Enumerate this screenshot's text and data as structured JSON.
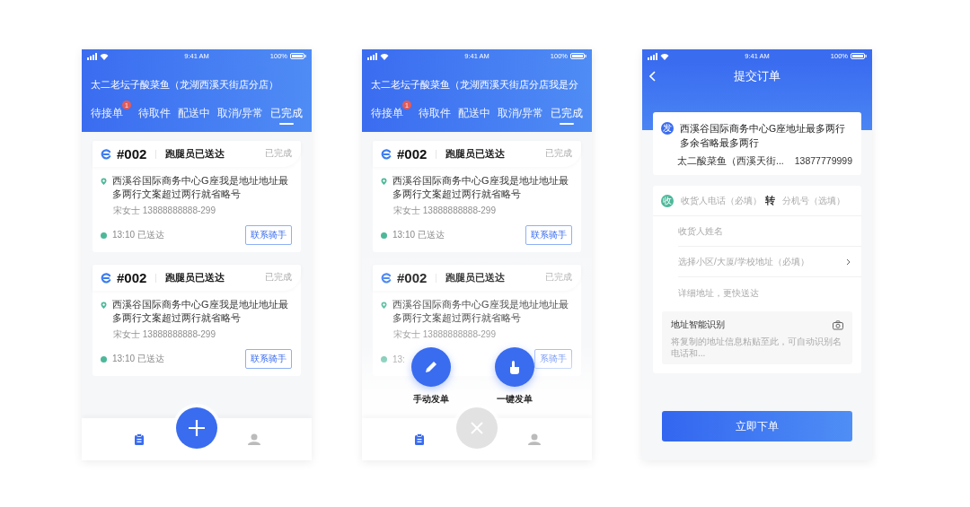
{
  "screens": [
    {
      "kind": "order_list",
      "status_bar": {
        "time": "9:41 AM",
        "battery": "100%"
      },
      "shop_title": "太二老坛子酸菜鱼（龙湖西溪天街店分店）",
      "tabs": [
        {
          "label": "待接单",
          "badge": "1",
          "selected": false
        },
        {
          "label": "待取件",
          "selected": false
        },
        {
          "label": "配送中",
          "selected": false
        },
        {
          "label": "取消/异常",
          "selected": false
        },
        {
          "label": "已完成",
          "selected": true
        }
      ],
      "orders": [
        {
          "number": "#002",
          "status": "跑腿员已送达",
          "state": "已完成",
          "address": "西溪谷国际商务中心G座我是地址地址最多两行文案超过两行就省略号",
          "contact": "宋女士  13888888888-299",
          "time_status": "13:10 已送达",
          "action": "联系骑手"
        },
        {
          "number": "#002",
          "status": "跑腿员已送达",
          "state": "已完成",
          "address": "西溪谷国际商务中心G座我是地址地址最多两行文案超过两行就省略号",
          "contact": "宋女士  13888888888-299",
          "time_status": "13:10 已送达",
          "action": "联系骑手"
        }
      ],
      "menu_open": false,
      "bottom_nav": [
        {
          "selected": true
        },
        {
          "selected": false
        }
      ]
    },
    {
      "kind": "order_list",
      "status_bar": {
        "time": "9:41 AM",
        "battery": "100%"
      },
      "shop_title": "太二老坛子酸菜鱼（龙湖西溪天街店分店我是分",
      "tabs": [
        {
          "label": "待接单",
          "badge": "1",
          "selected": false
        },
        {
          "label": "待取件",
          "selected": false
        },
        {
          "label": "配送中",
          "selected": false
        },
        {
          "label": "取消/异常",
          "selected": false
        },
        {
          "label": "已完成",
          "selected": true
        }
      ],
      "orders": [
        {
          "number": "#002",
          "status": "跑腿员已送达",
          "state": "已完成",
          "address": "西溪谷国际商务中心G座我是地址地址最多两行文案超过两行就省略号",
          "contact": "宋女士  13888888888-299",
          "time_status": "13:10 已送达",
          "action": "联系骑手"
        },
        {
          "number": "#002",
          "status": "跑腿员已送达",
          "state": "已完成",
          "address": "西溪谷国际商务中心G座我是地址地址最多两行文案超过两行就省略号",
          "contact": "宋女士  13888888888-299",
          "time_status": "13:",
          "action": "系骑手"
        }
      ],
      "menu_open": true,
      "actions": [
        {
          "label": "手动发单"
        },
        {
          "label": "一键发单"
        }
      ],
      "bottom_nav": [
        {
          "selected": true
        },
        {
          "selected": false
        }
      ]
    },
    {
      "kind": "submit_order",
      "status_bar": {
        "time": "9:41 AM",
        "battery": "100%"
      },
      "title": "提交订单",
      "sender": {
        "badge": "发",
        "address": "西溪谷国际商务中心G座地址最多两行多余省略最多两行",
        "name": "太二酸菜鱼（西溪天街...",
        "phone": "13877779999"
      },
      "receiver": {
        "badge": "收",
        "fields": [
          {
            "kind": "phone",
            "placeholder": "收货人电话（必填）",
            "transfer": "转",
            "ext_placeholder": "分机号（选填）"
          },
          {
            "kind": "text",
            "placeholder": "收货人姓名"
          },
          {
            "kind": "select",
            "placeholder": "选择小区/大厦/学校地址（必填）"
          },
          {
            "kind": "text",
            "placeholder": "详细地址，更快送达"
          }
        ]
      },
      "smart_parse": {
        "title": "地址智能识别",
        "placeholder": "将复制的地址信息粘贴至此，可自动识别名电话和..."
      },
      "submit_button": "立即下单"
    }
  ]
}
